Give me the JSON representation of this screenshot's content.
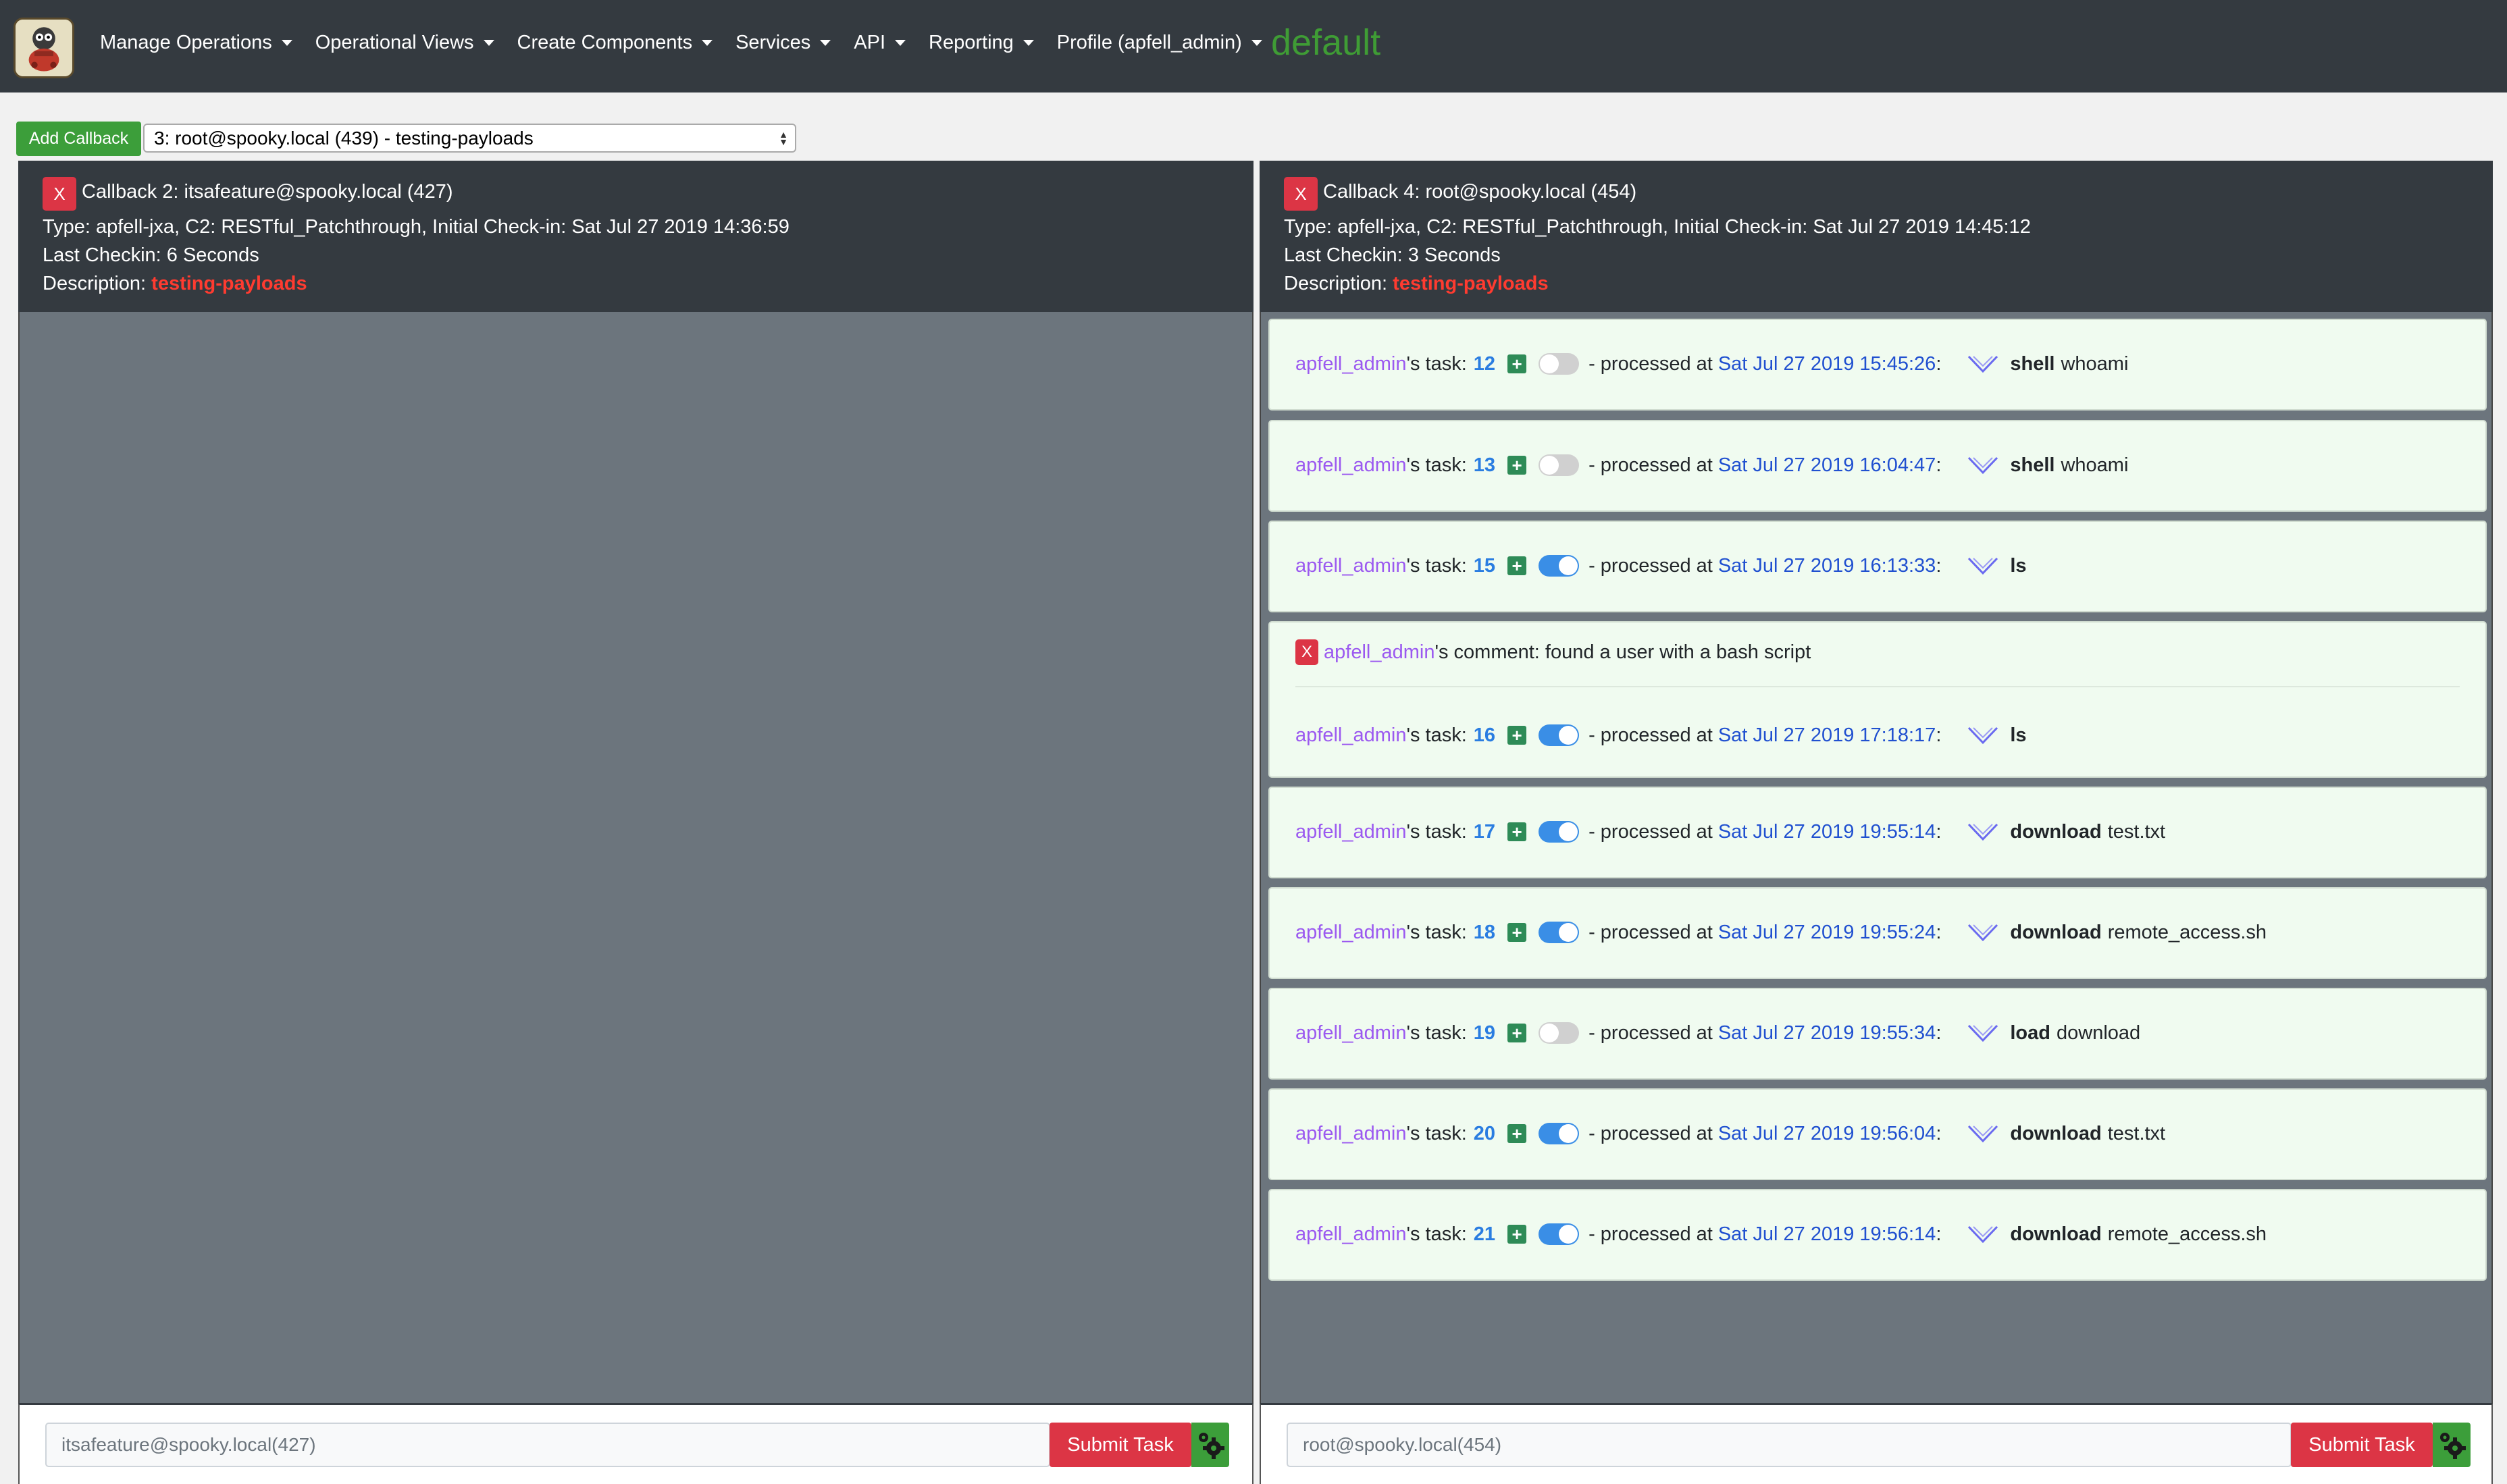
{
  "navbar": {
    "items": [
      {
        "label": "Manage Operations"
      },
      {
        "label": "Operational Views"
      },
      {
        "label": "Create Components"
      },
      {
        "label": "Services"
      },
      {
        "label": "API"
      },
      {
        "label": "Reporting"
      },
      {
        "label": "Profile (apfell_admin)"
      }
    ],
    "operation_name": "default",
    "logo_icon": "apfell-logo-icon"
  },
  "toolbar": {
    "add_callback_label": "Add Callback",
    "callback_select_value": "3: root@spooky.local (439) - testing-payloads"
  },
  "callbacks": [
    {
      "title": "Callback 2: itsafeature@spooky.local (427)",
      "type_line": "Type: apfell-jxa, C2: RESTful_Patchthrough, Initial Check-in: Sat Jul 27 2019 14:36:59",
      "checkin_line": "Last Checkin: 6 Seconds",
      "desc_label": "Description: ",
      "desc_value": "testing-payloads",
      "close_label": "X",
      "input_placeholder": "itsafeature@spooky.local(427)",
      "submit_label": "Submit Task"
    },
    {
      "title": "Callback 4: root@spooky.local (454)",
      "type_line": "Type: apfell-jxa, C2: RESTful_Patchthrough, Initial Check-in: Sat Jul 27 2019 14:45:12",
      "checkin_line": "Last Checkin: 3 Seconds",
      "desc_label": "Description: ",
      "desc_value": "testing-payloads",
      "close_label": "X",
      "input_placeholder": "root@spooky.local(454)",
      "submit_label": "Submit Task"
    }
  ],
  "task_labels": {
    "task_suffix": "'s task:",
    "processed_prefix": "- processed at",
    "colon": ":"
  },
  "comment": {
    "user": "apfell_admin",
    "text": "'s comment: found a user with a bash script",
    "close_label": "X"
  },
  "tasks": [
    {
      "user": "apfell_admin",
      "id": "12",
      "toggle": "off",
      "timestamp": "Sat Jul 27 2019 15:45:26",
      "command": "shell",
      "params": "whoami"
    },
    {
      "user": "apfell_admin",
      "id": "13",
      "toggle": "off",
      "timestamp": "Sat Jul 27 2019 16:04:47",
      "command": "shell",
      "params": "whoami"
    },
    {
      "user": "apfell_admin",
      "id": "15",
      "toggle": "on",
      "timestamp": "Sat Jul 27 2019 16:13:33",
      "command": "ls",
      "params": ""
    },
    {
      "user": "apfell_admin",
      "id": "16",
      "toggle": "on",
      "timestamp": "Sat Jul 27 2019 17:18:17",
      "command": "ls",
      "params": ""
    },
    {
      "user": "apfell_admin",
      "id": "17",
      "toggle": "on",
      "timestamp": "Sat Jul 27 2019 19:55:14",
      "command": "download",
      "params": "test.txt"
    },
    {
      "user": "apfell_admin",
      "id": "18",
      "toggle": "on",
      "timestamp": "Sat Jul 27 2019 19:55:24",
      "command": "download",
      "params": "remote_access.sh"
    },
    {
      "user": "apfell_admin",
      "id": "19",
      "toggle": "off",
      "timestamp": "Sat Jul 27 2019 19:55:34",
      "command": "load",
      "params": "download"
    },
    {
      "user": "apfell_admin",
      "id": "20",
      "toggle": "on",
      "timestamp": "Sat Jul 27 2019 19:56:04",
      "command": "download",
      "params": "test.txt"
    },
    {
      "user": "apfell_admin",
      "id": "21",
      "toggle": "on",
      "timestamp": "Sat Jul 27 2019 19:56:14",
      "command": "download",
      "params": "remote_access.sh"
    }
  ],
  "colors": {
    "navbar_bg": "#343a40",
    "operation_green": "#3f9c35",
    "danger_red": "#dc3545",
    "success_green": "#3c9e3a",
    "user_purple": "#9b59f0",
    "task_id_blue": "#2a7de1",
    "timestamp_blue": "#2050d0",
    "panel_body_gray": "#6c757d",
    "task_card_bg": "#f0fbf0"
  }
}
